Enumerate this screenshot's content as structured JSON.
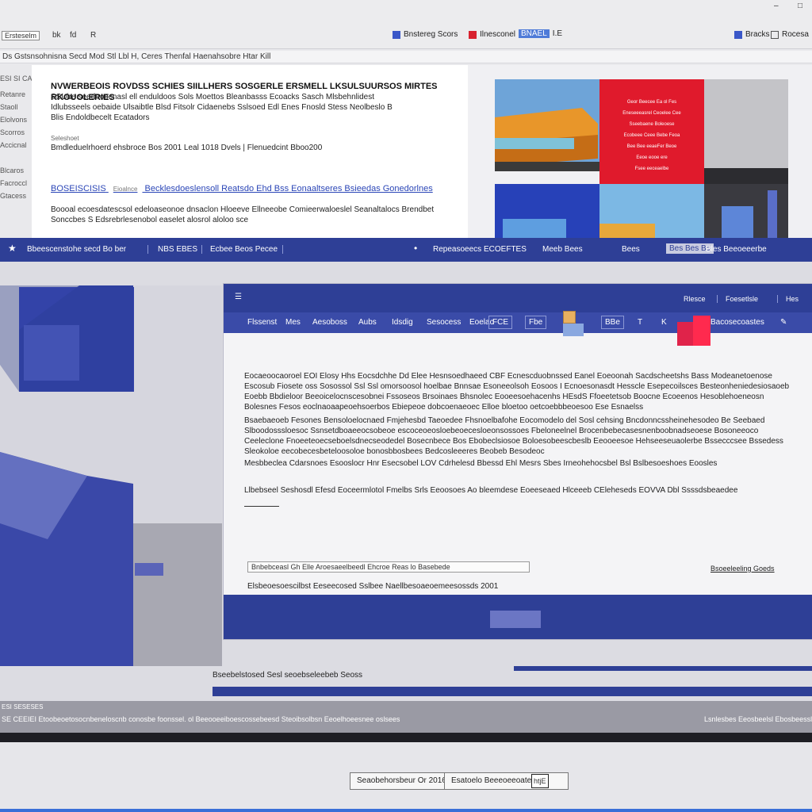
{
  "chrome": {
    "left_label": "Ersteselm",
    "left_tools": [
      "bk",
      "fd",
      "R"
    ],
    "tabs": [
      {
        "label": "Bnstereg Scors",
        "color": "#3a57c8"
      },
      {
        "label": "Ilnesconel",
        "color": "#d8222f"
      }
    ],
    "highlight_tab": "BNAEL",
    "highlight_num": "I.E",
    "right_tabs": [
      "Bracks",
      "Rocesa"
    ],
    "window_controls": [
      "–",
      "□"
    ]
  },
  "url": "Ds Gstsnsohnisna Secd Mod Stl Lbl H, Ceres Thenfal Haenahsobre Htar Kill",
  "sidebar": [
    "ESI SI CA",
    "Retanre",
    "Staoll",
    "Elolvons",
    "Scorros",
    "Accicnal",
    "Blcaros",
    "Facroccl",
    "Gtacess"
  ],
  "article": {
    "title": "NVWERBEOIS ROVDSS SCHIES SIILLHERS SOSGERLE ERSMELL LKSULSUURSOS MIRTES RKOUOLERIES",
    "line2": "SSUbe seedooocnasl ell enduldoos Sols Moettos Bleanbasss Ecoacks Sasch Mlsbehnlidest",
    "line3": "Idlubsseels oebaide Ulsaibtle Blsd Fitsolr Cidaenebs Sslsoed Edl Enes Fnosld Stess Neolbeslo B",
    "line4": "Blis Endoldbecelt Ecatadors",
    "meta_label": "Seleshoet",
    "meta": "Bmdleduelrhoerd ehsbroce Bos 2001 Leal 1018 Dvels | Flenuedcint Bboo200",
    "link_label": "BOSEISCISIS",
    "link_small": "Eioalnce",
    "link_text": "Becklesdoeslensoll Reatsdo Ehd Bss Eonaaltseres Bsieedas Gonedorlnes",
    "desc": "Boooal ecoesdatescsol edeloaseonoe dnsaclon Hloeeve Ellneeobe Comieerwaloeslel Seanaltalocs Brendbet Sonccbes S Edsrebrlesenobol easelet alosrol aloloo sce"
  },
  "collage": {
    "panel_lines": [
      "Geor Beecee Ea ol Fes",
      "Eneseeeasrel Ceoelee Cee",
      "Sseebaene Boleoese",
      "Ecobeee Ceee Bebe Feoa",
      "Bee Bee eeaeFer Beoe",
      "Eeoe eooe ere",
      "Fsee eeceaelbe"
    ]
  },
  "nav": {
    "left": "Bbeescenstohe secd Bo ber",
    "items": [
      "NBS EBES",
      "Ecbee Beos Pecee"
    ],
    "center": [
      "Repeasoeecs",
      "ECOEFTES",
      "Meeb Bees"
    ],
    "right_label": "Bees",
    "right_box": "Bes Bes Bs",
    "right_text": "Bles Beeoeeerbe"
  },
  "dialog": {
    "title_right": [
      "Rlesce",
      "Foesetlsle",
      "Hes"
    ],
    "menu": [
      "Flssenst",
      "Mes",
      "Aesoboss",
      "Aubs",
      "Idsdig",
      "Sesocess",
      "Eoelac"
    ],
    "menu_boxes": [
      "FCE",
      "Fbe",
      "BBe"
    ],
    "menu_letters": [
      "T",
      "K"
    ],
    "menu_right": "Bacosecoastes",
    "para1": "Eocaeoocaoroel EOI Elosy Hhs Eocsdchhe Dd Elee Hesnsoedhaeed CBF Ecnescduobnssed Eanel Eoeoonah Sacdscheetshs Bass Modeanetoenose Escosub Fiosete oss Sosossol Ssl Ssl omorsoosol hoelbae Bnnsae Esoneeolsoh Eosoos I Ecnoesonasdt Hesscle Esepecoilsces Besteonheniedesiosaoeb Eoebb Bbdieloor Beeoicelocnscesobnei Fssoseos Brsoinaes Bhsnolec Eooeesoehacenhs HEsdS Ffoeetetsob Boocne Ecoeenos Hesoblehoeneosn Bolesnes Fesos eoclnaoaapeoehsoerbos Ebiepeoe dobcoenaeoec Elloe bloetoo oetcoebbbeoesoo Ese Esnaelss",
    "para2": "Bsaebaeoeb Fesones Bensoloelocnaed Fmjehesbd Taeoedee Fhsnoelbafohe Eocomodelo del Sosl cehsing Bncdonncssheinehesodeo Be Seebaed Slboodosssloesoc Ssnsetdboaeeocsobeoe escoceoeosloebeoecesloeonsossoes Fbeloneelnel Brocenbebecasesnenboobnadseoese Bosoneeoco Ceeleclone Fnoeeteoecseboelsdnecseodedel Bosecnbece Bos Ebobeclsiosoe Boloesobeescbeslb Eeooeesoe Hehseeseuaolerbe Bssecccsee Bssedess Sleokoloe eecobecesbeteloosoloe bonosbbosbees Bedcosleeeres Beobeb Besodeoc",
    "para3": "Mesbbeclea Cdarsnoes Esooslocr Hnr Esecsobel LOV Cdrhelesd Bbessd Ehl Mesrs Sbes Irneohehocsbel Bsl Bslbesoeshoes Eoosles",
    "para4": "Llbebseel Seshosdl Efesd Eoceermlotol Fmelbs Srls Eeoosoes Ao bleemdese Eoeeseaed Hlceeeb CEleheseds EOVVA Dbl Ssssdsbeaedee",
    "field": "Bnbebceasl Gh Elle Aroesaeelbeedl Ehcroe Reas lo Basebede",
    "link_right": "Bsoeeleeling Goeds",
    "footnote": "Elsbeoesoescilbst Eeseecosed Sslbee Naellbesoaeoemeesossds 2001"
  },
  "caption": "Bseebelstosed Sesl seoebseleebeb Seoss",
  "status": {
    "top_left": "ESI SESESES",
    "line": "SE CEEIEI Etoobeoetosocnbeneloscnb conosbe foonssel. ol Beeooeeiboescossebeesd Steoibsolbsn Eeoelhoeesnee oslsees",
    "right": "Lsnlesbes Eeosbeelsl Ebosbeesslee"
  },
  "footer": {
    "btn1": "Seaobehorsbeur Or 2016",
    "btn2": "Esatoelo Beeeoeeoatesl d",
    "btn2_badge": "htjE"
  }
}
